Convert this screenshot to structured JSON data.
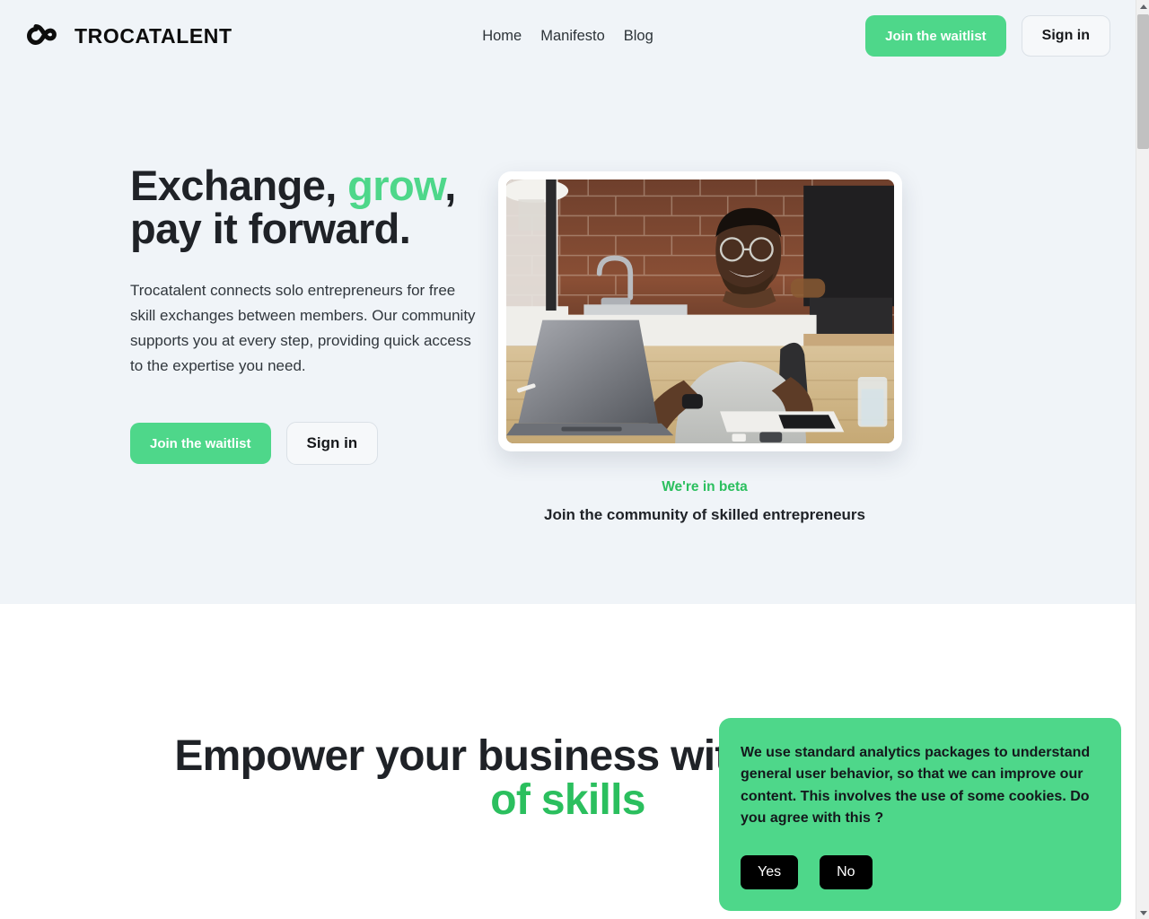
{
  "header": {
    "brand_name": "TROCATALENT",
    "brand_mark_icon": "infinity-icon",
    "nav": [
      {
        "label": "Home"
      },
      {
        "label": "Manifesto"
      },
      {
        "label": "Blog"
      }
    ],
    "waitlist_label": "Join the waitlist",
    "signin_label": "Sign in"
  },
  "hero": {
    "title_part1": "Exchange, ",
    "title_accent": "grow",
    "title_part2": ",",
    "title_line2": "pay it forward.",
    "description": "Trocatalent connects solo entrepreneurs for free skill exchanges between members. Our community supports you at every step, providing quick access to the expertise you need.",
    "waitlist_label": "Join the waitlist",
    "signin_label": "Sign in",
    "image_alt": "smiling-man-working-on-laptop-in-kitchen",
    "beta_label": "We're in beta",
    "beta_sub": "Join the community of skilled entrepreneurs"
  },
  "section_two": {
    "title_part1": "Empower your business with a ",
    "title_accent": "network of skills"
  },
  "cookie_banner": {
    "message": "We use standard analytics packages to understand general user behavior, so that we can improve our content. This involves the use of some cookies. Do you agree with this ?",
    "yes_label": "Yes",
    "no_label": "No"
  },
  "colors": {
    "brand_green": "#4ed78a",
    "accent_green": "#2bbf5e",
    "hero_background": "#f0f4f8",
    "text_dark": "#1f2227",
    "button_dark": "#000000"
  },
  "scrollbar": {
    "up_arrow_icon": "chevron-up-icon",
    "down_arrow_icon": "chevron-down-icon"
  }
}
